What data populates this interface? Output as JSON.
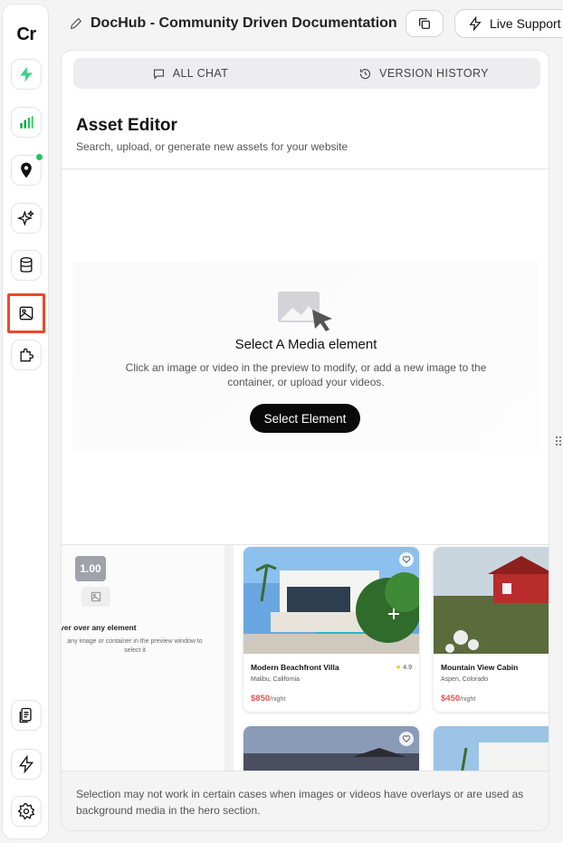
{
  "rail": {
    "logo": "Cr",
    "items": [
      {
        "name": "supabase-icon"
      },
      {
        "name": "analytics-icon"
      },
      {
        "name": "location-icon"
      },
      {
        "name": "ai-sparkle-icon"
      },
      {
        "name": "database-icon"
      },
      {
        "name": "image-icon",
        "active": true
      },
      {
        "name": "puzzle-icon"
      },
      {
        "name": "pages-icon"
      },
      {
        "name": "lightning-icon"
      },
      {
        "name": "gear-icon"
      }
    ]
  },
  "header": {
    "title": "DocHub - Community Driven Documentation",
    "live_support": "Live Support"
  },
  "tabs": [
    {
      "label": "ALL CHAT"
    },
    {
      "label": "VERSION HISTORY"
    }
  ],
  "asset_editor": {
    "title": "Asset Editor",
    "subtitle": "Search, upload, or generate new assets for your website",
    "empty_title": "Select A Media element",
    "empty_desc": "Click an image or video in the preview to modify, or add a new image to the container, or upload your videos.",
    "select_button": "Select Element"
  },
  "preview": {
    "zoom": "1.00",
    "hover_title": "ver over any element",
    "hover_sub": "any image or container in the preview window to select it",
    "cards": [
      {
        "name": "Modern Beachfront Villa",
        "location": "Malibu, California",
        "price": "$850",
        "per": "/night",
        "rating": "4.9"
      },
      {
        "name": "Mountain View Cabin",
        "location": "Aspen, Colorado",
        "price": "$450",
        "per": "/night"
      }
    ]
  },
  "note": "Selection may not work in certain cases when images or videos have overlays or are used as background media in the hero section.",
  "colors": {
    "accent_green": "#22c55e",
    "active_outline": "#ea4a2a",
    "price_red": "#e25555"
  }
}
